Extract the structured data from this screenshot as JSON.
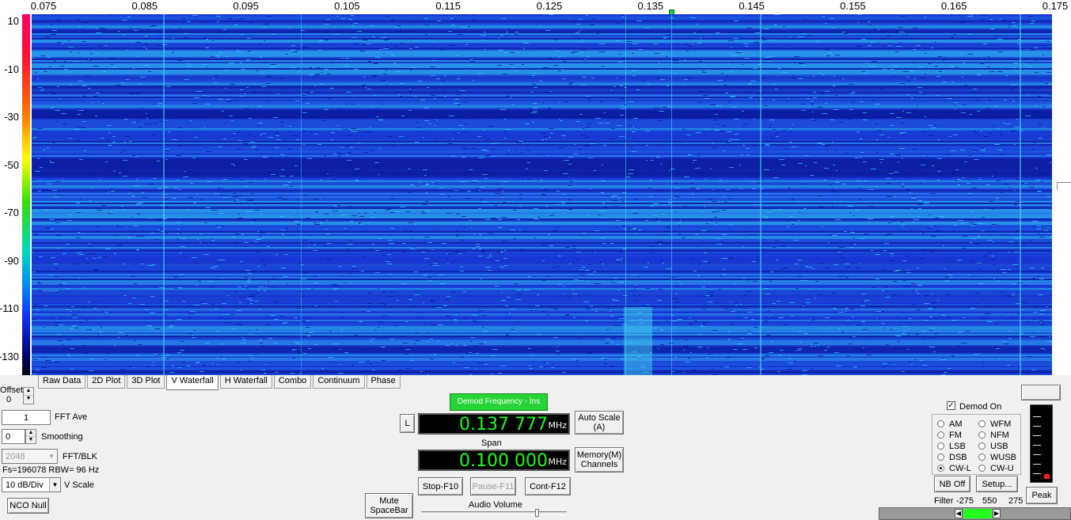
{
  "freq_axis": {
    "ticks": [
      "0.075",
      "0.085",
      "0.095",
      "0.105",
      "0.115",
      "0.125",
      "0.135",
      "0.145",
      "0.155",
      "0.165",
      "0.175"
    ]
  },
  "db_scale": {
    "ticks": [
      "10",
      "-10",
      "-30",
      "-50",
      "-70",
      "-90",
      "-110",
      "-130"
    ]
  },
  "tabs": [
    {
      "label": "Raw Data"
    },
    {
      "label": "2D Plot"
    },
    {
      "label": "3D Plot"
    },
    {
      "label": "V Waterfall",
      "active": true
    },
    {
      "label": "H Waterfall"
    },
    {
      "label": "Combo"
    },
    {
      "label": "Continuum"
    },
    {
      "label": "Phase"
    }
  ],
  "left_panel": {
    "offset_label": "Offset",
    "offset_value": "0",
    "fft_ave_value": "1",
    "fft_ave_label": "FFT Ave",
    "smoothing_value": "0",
    "smoothing_label": "Smoothing",
    "fft_blk_value": "2048",
    "fft_blk_label": "FFT/BLK",
    "fs_text": "Fs=196078 RBW=  96 Hz",
    "vscale_value": "10 dB/Div",
    "vscale_label": "V Scale",
    "nco_null_label": "NCO Null"
  },
  "center_panel": {
    "demod_freq_label": "Demod Frequency - Ins",
    "l_button": "L",
    "demod_freq_value": "0.137 777",
    "demod_freq_unit": "MHz",
    "auto_scale_line1": "Auto Scale",
    "auto_scale_line2": "(A)",
    "span_label": "Span",
    "span_value": "0.100 000",
    "span_unit": "MHz",
    "memory_line1": "Memory(M)",
    "memory_line2": "Channels",
    "stop_label": "Stop-F10",
    "pause_label": "Pause-F11",
    "cont_label": "Cont-F12",
    "mute_line1": "Mute",
    "mute_line2": "SpaceBar",
    "audio_volume_label": "Audio Volume",
    "audio_volume_level": 0.8
  },
  "right_panel": {
    "demod_on_label": "Demod On",
    "demod_on_checked": true,
    "modes_left": [
      {
        "label": "AM",
        "selected": false
      },
      {
        "label": "FM",
        "selected": false
      },
      {
        "label": "LSB",
        "selected": false
      },
      {
        "label": "DSB",
        "selected": false
      },
      {
        "label": "CW-L",
        "selected": true
      }
    ],
    "modes_right": [
      {
        "label": "WFM",
        "selected": false
      },
      {
        "label": "NFM",
        "selected": false
      },
      {
        "label": "USB",
        "selected": false
      },
      {
        "label": "WUSB",
        "selected": false
      },
      {
        "label": "CW-U",
        "selected": false
      }
    ],
    "nb_off_label": "NB Off",
    "setup_label": "Setup...",
    "peak_label": "Peak",
    "filter_label": "Filter",
    "filter_low": "-275",
    "filter_width": "550",
    "filter_high": "275"
  },
  "colors": {
    "waterfall_base": "#1836d4",
    "lcd_text": "#12ff12",
    "demod_button": "#26d436"
  }
}
